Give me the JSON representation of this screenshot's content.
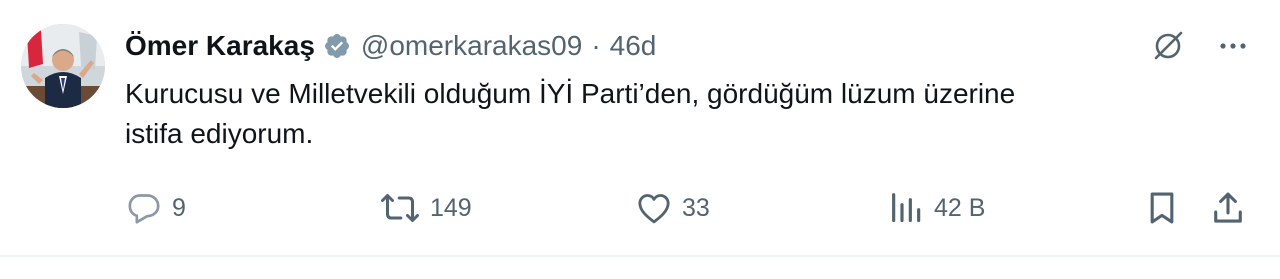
{
  "author": {
    "display_name": "Ömer Karakaş",
    "handle": "@omerkarakas09",
    "separator": "·",
    "time": "46d"
  },
  "tweet": {
    "text": "Kurucusu ve Milletvekili olduğum İYİ Parti’den, gördüğüm lüzum üzerine\nistifa ediyorum."
  },
  "actions": {
    "replies": "9",
    "retweets": "149",
    "likes": "33",
    "views": "42 B"
  },
  "icons": {
    "verified": "verified-badge-icon",
    "grok": "grok-icon",
    "more": "more-icon",
    "reply": "reply-icon",
    "retweet": "retweet-icon",
    "like": "heart-icon",
    "views": "views-icon",
    "bookmark": "bookmark-icon",
    "share": "share-icon"
  },
  "colors": {
    "text": "#0f1419",
    "secondary": "#536471",
    "verified": "#829aab",
    "divider": "#eff3f4"
  }
}
